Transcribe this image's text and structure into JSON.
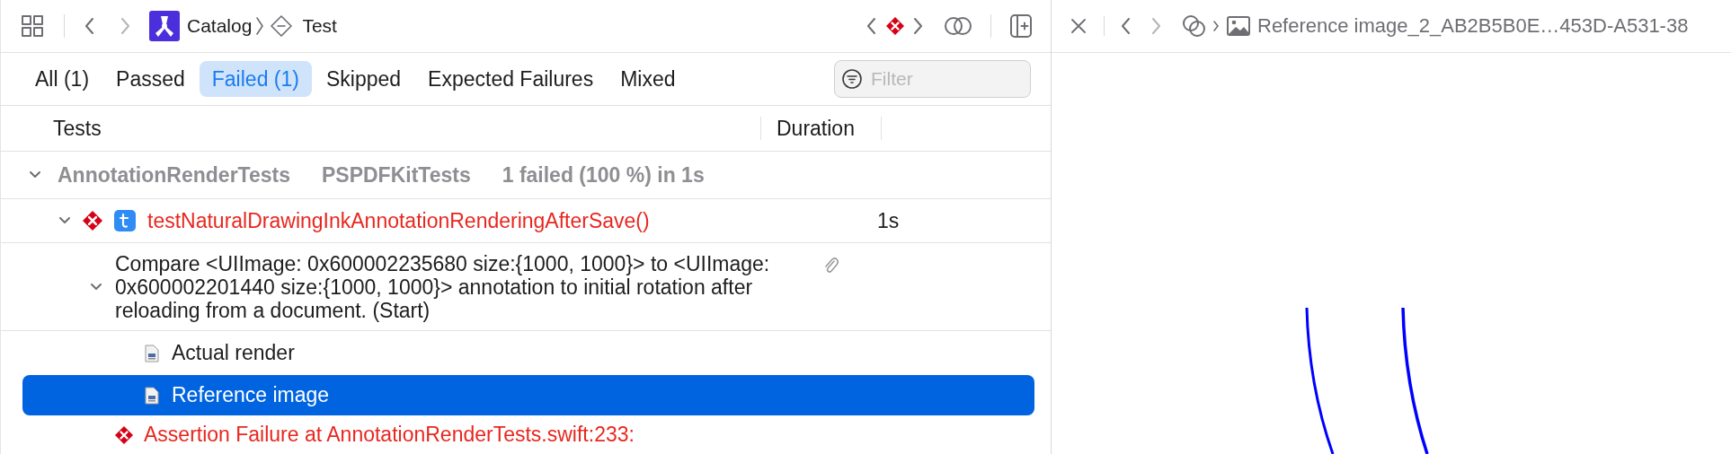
{
  "toolbar": {
    "breadcrumbs": [
      "Catalog",
      "Test"
    ]
  },
  "filter_tabs": [
    {
      "label": "All (1)",
      "selected": false
    },
    {
      "label": "Passed",
      "selected": false
    },
    {
      "label": "Failed (1)",
      "selected": true
    },
    {
      "label": "Skipped",
      "selected": false
    },
    {
      "label": "Expected Failures",
      "selected": false
    },
    {
      "label": "Mixed",
      "selected": false
    }
  ],
  "filter": {
    "placeholder": "Filter"
  },
  "columns": [
    "Tests",
    "Duration"
  ],
  "group": {
    "name": "AnnotationRenderTests",
    "target": "PSPDFKitTests",
    "summary": "1 failed (100 %) in 1s",
    "expanded": true
  },
  "test": {
    "name": "testNaturalDrawingInkAnnotationRenderingAfterSave()",
    "duration": "1s",
    "failed": true,
    "expanded": true
  },
  "activity": {
    "text": "Compare <UIImage: 0x600002235680 size:{1000, 1000}> to <UIImage: 0x600002201440 size:{1000, 1000}> annotation to initial rotation after reloading from a document. (Start)",
    "expanded": true
  },
  "attachments": [
    {
      "label": "Actual render",
      "selected": false
    },
    {
      "label": "Reference image",
      "selected": true
    }
  ],
  "failure": {
    "text": "Assertion Failure at AnnotationRenderTests.swift:233:"
  },
  "viewer": {
    "title": "Reference image_2_AB2B5B0E…453D-A531-38"
  }
}
